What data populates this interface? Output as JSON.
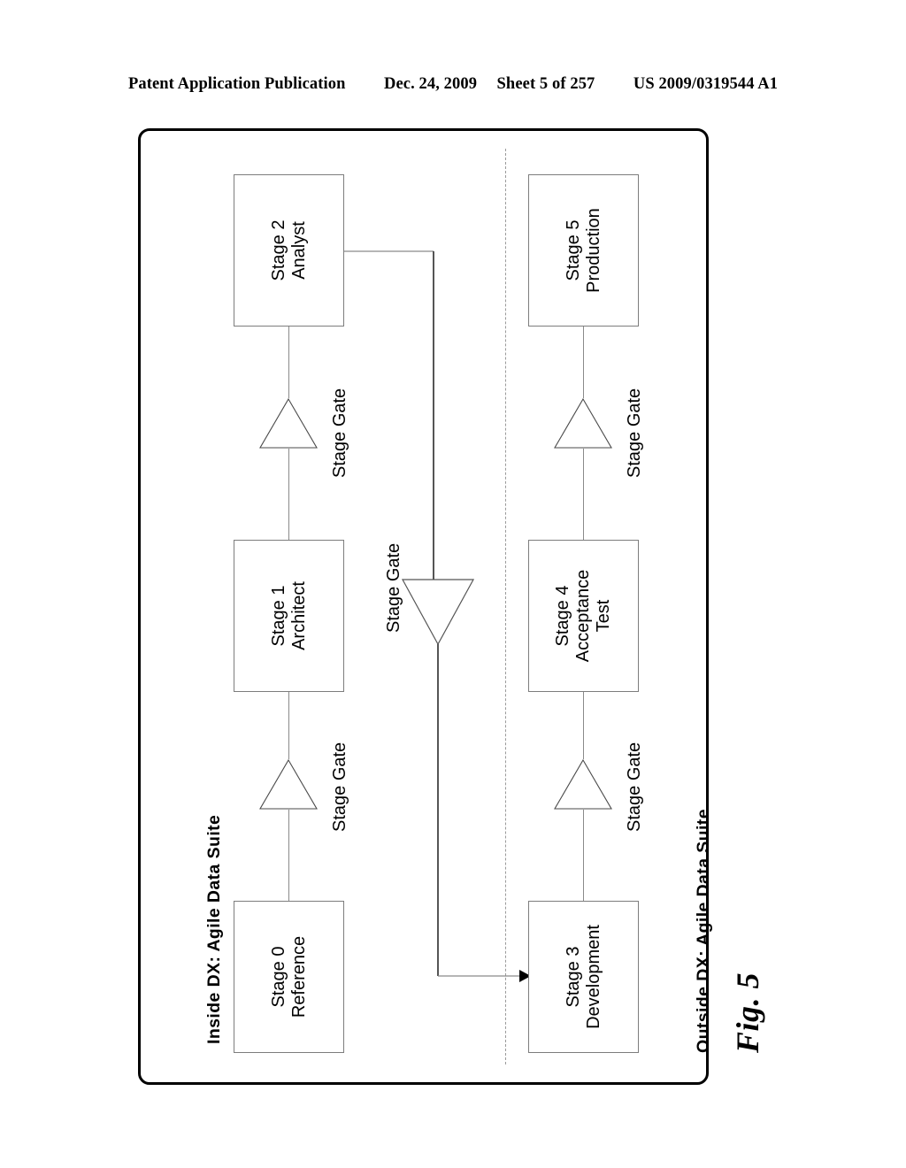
{
  "header": {
    "publication": "Patent Application Publication",
    "date": "Dec. 24, 2009",
    "sheet": "Sheet 5 of 257",
    "patent_number": "US 2009/0319544 A1"
  },
  "figure": {
    "caption": "Fig. 5",
    "inside_label": "Inside DX: Agile Data Suite",
    "outside_label": "Outside DX: Agile Data Suite",
    "gate_label": "Stage Gate"
  },
  "stages": [
    {
      "id": "stage0",
      "title": "Stage 0",
      "subtitle": "Reference",
      "side": "inside"
    },
    {
      "id": "stage1",
      "title": "Stage 1",
      "subtitle": "Architect",
      "side": "inside"
    },
    {
      "id": "stage2",
      "title": "Stage 2",
      "subtitle": "Analyst",
      "side": "inside"
    },
    {
      "id": "stage3",
      "title": "Stage 3",
      "subtitle": "Development",
      "side": "outside"
    },
    {
      "id": "stage4",
      "title": "Stage 4",
      "subtitle": "Acceptance",
      "subtitle2": "Test",
      "side": "outside"
    },
    {
      "id": "stage5",
      "title": "Stage 5",
      "subtitle": "Production",
      "side": "outside"
    }
  ],
  "gates": [
    {
      "id": "gate-0-1",
      "label": "Stage Gate",
      "orientation": "up",
      "between": "Stage 0 - Stage 1"
    },
    {
      "id": "gate-1-2",
      "label": "Stage Gate",
      "orientation": "up",
      "between": "Stage 1 - Stage 2"
    },
    {
      "id": "gate-2-3",
      "label": "Stage Gate",
      "orientation": "down",
      "between": "Stage 2 - Stage 3"
    },
    {
      "id": "gate-3-4",
      "label": "Stage Gate",
      "orientation": "up",
      "between": "Stage 3 - Stage 4"
    },
    {
      "id": "gate-4-5",
      "label": "Stage Gate",
      "orientation": "up",
      "between": "Stage 4 - Stage 5"
    }
  ],
  "colors": {
    "frame": "#000000",
    "box_border": "#7d7d7d",
    "connector": "#8a8a8a",
    "divider": "#9a9a9a",
    "text": "#000000",
    "background": "#ffffff"
  }
}
